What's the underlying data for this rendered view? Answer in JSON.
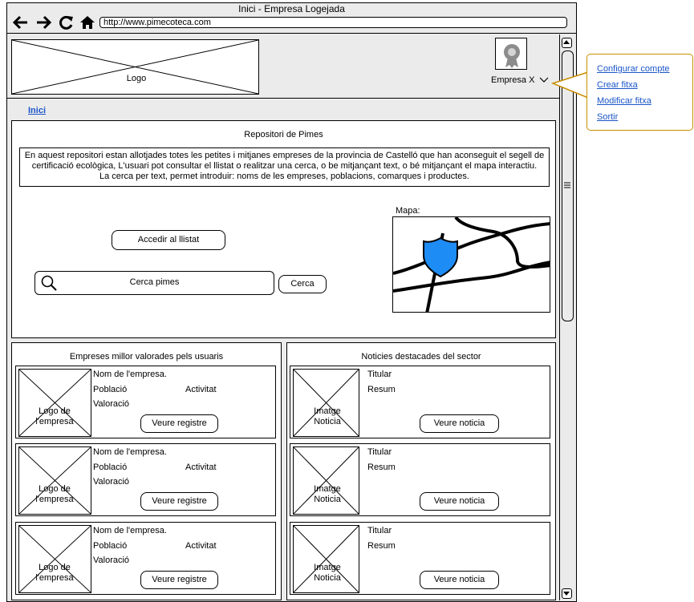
{
  "window": {
    "title": "Inici - Empresa Logejada"
  },
  "browser": {
    "back_icon": "back-arrow-icon",
    "forward_icon": "forward-arrow-icon",
    "reload_icon": "reload-icon",
    "home_icon": "home-icon",
    "url": "http://www.pimecoteca.com"
  },
  "header": {
    "logo_label": "Logo",
    "account_name": "Empresa X",
    "account_icon": "award-badge-icon"
  },
  "breadcrumb": {
    "home": "Inici"
  },
  "repository": {
    "title": "Repositori de Pimes",
    "description_lines": [
      "En aquest repositori estan allotjades totes les petites i mitjanes empreses de la provincia de Castelló que han aconseguit el segell de",
      "certificació ecològica, L'usuari pot consultar el llistat o realitzar una cerca, o be mitjançant text, o bé mitjançant el mapa interactiu.",
      "La cerca per text, permet introduir: noms de les empreses, poblacions, comarques i productes."
    ],
    "list_button": "Accedir al llistat",
    "search_placeholder": "Cerca pimes",
    "search_button": "Cerca",
    "map_label": "Mapa:"
  },
  "top_companies": {
    "title": "Empreses millor valorades pels usuaris",
    "items": [
      {
        "logo_label": "Logo de l'empresa",
        "name": "Nom de l'empresa.",
        "population": "Població",
        "activity": "Activitat",
        "rating": "Valoració",
        "button": "Veure registre"
      },
      {
        "logo_label": "Logo de l'empresa",
        "name": "Nom de l'empresa.",
        "population": "Població",
        "activity": "Activitat",
        "rating": "Valoració",
        "button": "Veure registre"
      },
      {
        "logo_label": "Logo de l'empresa",
        "name": "Nom de l'empresa.",
        "population": "Població",
        "activity": "Activitat",
        "rating": "Valoració",
        "button": "Veure registre"
      }
    ]
  },
  "news": {
    "title": "Noticies destacades del sector",
    "items": [
      {
        "image_label": "Imatge Noticia",
        "headline": "Titular",
        "summary": "Resum",
        "button": "Veure noticia"
      },
      {
        "image_label": "Imatge Noticia",
        "headline": "Titular",
        "summary": "Resum",
        "button": "Veure noticia"
      },
      {
        "image_label": "Imatge Noticia",
        "headline": "Titular",
        "summary": "Resum",
        "button": "Veure noticia"
      }
    ]
  },
  "account_menu": {
    "items": [
      "Configurar compte",
      "Crear fitxa",
      "Modificar fitxa",
      "Sortir"
    ]
  },
  "colors": {
    "link": "#1a55c8",
    "callout_border": "#c98e00",
    "map_marker": "#1e8cf5",
    "chrome_bg": "#ebebeb"
  }
}
